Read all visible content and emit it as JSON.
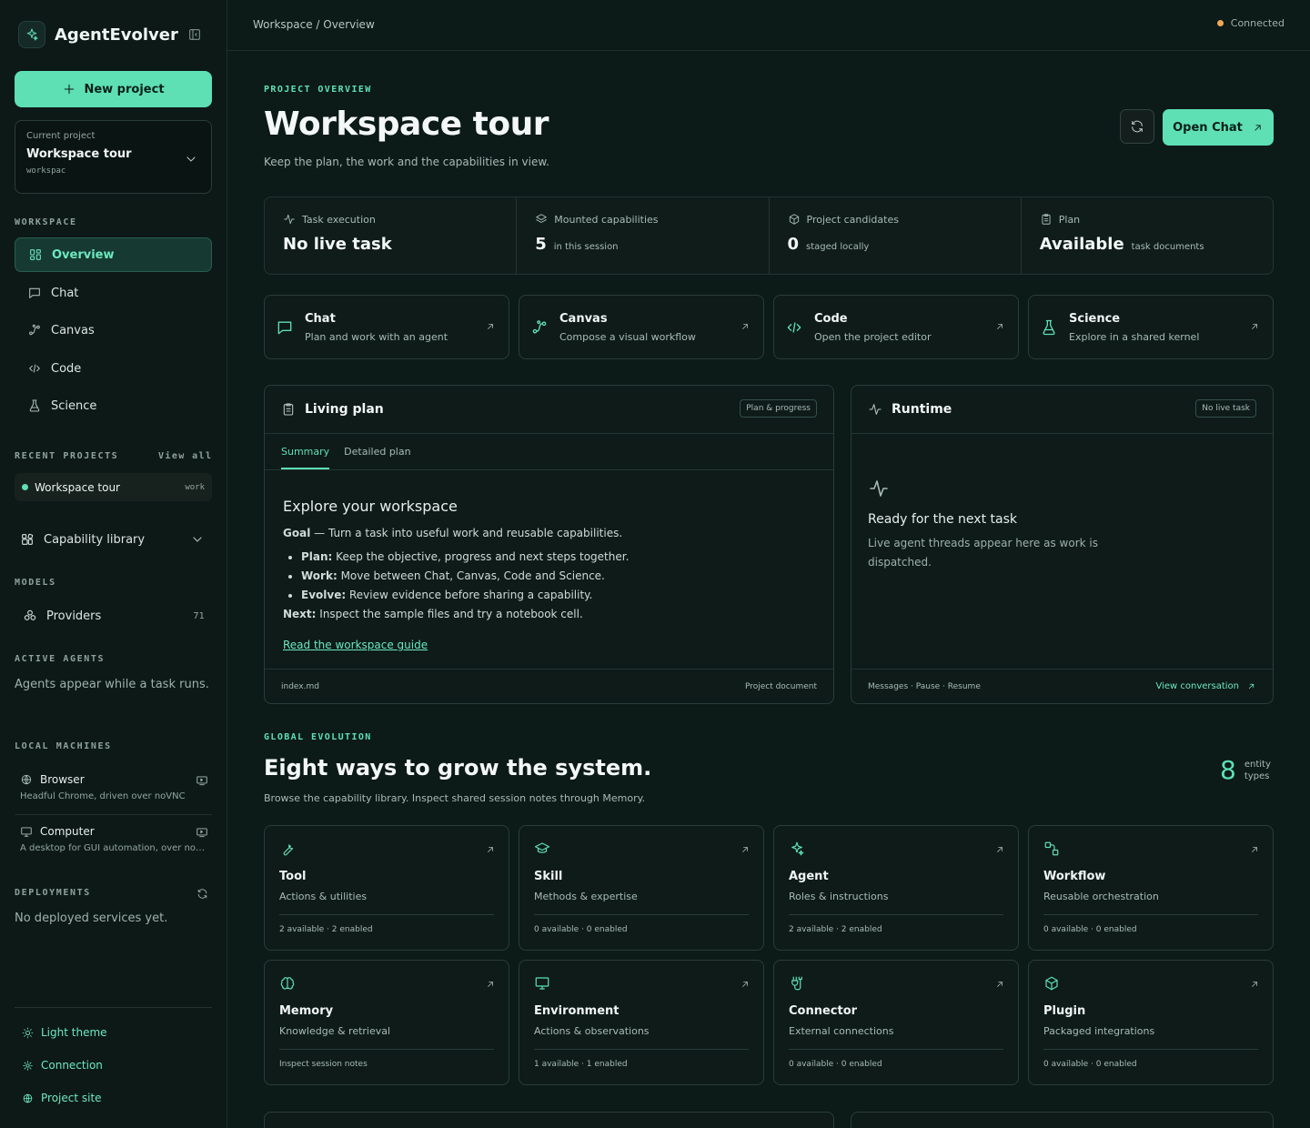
{
  "app": {
    "name": "AgentEvolver"
  },
  "sidebar": {
    "new_project": "New project",
    "project_picker": {
      "caption": "Current project",
      "name": "Workspace tour",
      "slug": "workspac"
    },
    "workspace_label": "WORKSPACE",
    "nav": [
      "Overview",
      "Chat",
      "Canvas",
      "Code",
      "Science"
    ],
    "recent_label": "RECENT PROJECTS",
    "view_all": "View all",
    "recent": {
      "name": "Workspace tour",
      "tag": "work"
    },
    "capability_library": "Capability library",
    "models_label": "MODELS",
    "providers": {
      "label": "Providers",
      "count": "71"
    },
    "active_agents_label": "ACTIVE AGENTS",
    "active_agents_text": "Agents appear while a task runs.",
    "local_machines_label": "LOCAL MACHINES",
    "machines": [
      {
        "name": "Browser",
        "desc": "Headful Chrome, driven over noVNC"
      },
      {
        "name": "Computer",
        "desc": "A desktop for GUI automation, over noVNC"
      }
    ],
    "deployments_label": "DEPLOYMENTS",
    "deployments_text": "No deployed services yet.",
    "footer": [
      "Light theme",
      "Connection",
      "Project site"
    ]
  },
  "topbar": {
    "breadcrumb": "Workspace / Overview",
    "status": "Connected"
  },
  "overview": {
    "eyebrow": "PROJECT OVERVIEW",
    "title": "Workspace tour",
    "subtitle": "Keep the plan, the work and the capabilities in view.",
    "open_chat": "Open Chat",
    "stats": [
      {
        "label": "Task execution",
        "value": "No live task",
        "note": ""
      },
      {
        "label": "Mounted capabilities",
        "value": "5",
        "note": "in this session"
      },
      {
        "label": "Project candidates",
        "value": "0",
        "note": "staged locally"
      },
      {
        "label": "Plan",
        "value": "Available",
        "note": "task documents"
      }
    ],
    "quick": [
      {
        "title": "Chat",
        "sub": "Plan and work with an agent"
      },
      {
        "title": "Canvas",
        "sub": "Compose a visual workflow"
      },
      {
        "title": "Code",
        "sub": "Open the project editor"
      },
      {
        "title": "Science",
        "sub": "Explore in a shared kernel"
      }
    ]
  },
  "plan": {
    "title": "Living plan",
    "badge": "Plan & progress",
    "tabs": [
      "Summary",
      "Detailed plan"
    ],
    "heading": "Explore your workspace",
    "goal_label": "Goal",
    "goal_text": " — Turn a task into useful work and reusable capabilities.",
    "items": [
      {
        "label": "Plan:",
        "text": " Keep the objective, progress and next steps together."
      },
      {
        "label": "Work:",
        "text": " Move between Chat, Canvas, Code and Science."
      },
      {
        "label": "Evolve:",
        "text": " Review evidence before sharing a capability."
      }
    ],
    "next_label": "Next:",
    "next_text": " Inspect the sample files and try a notebook cell.",
    "link": "Read the workspace guide",
    "footer_left": "index.md",
    "footer_right": "Project document"
  },
  "runtime": {
    "title": "Runtime",
    "badge": "No live task",
    "heading": "Ready for the next task",
    "text": "Live agent threads appear here as work is dispatched.",
    "footer_left": "Messages · Pause · Resume",
    "footer_link": "View conversation"
  },
  "evolution": {
    "eyebrow": "GLOBAL EVOLUTION",
    "title": "Eight ways to grow the system.",
    "subtitle": "Browse the capability library. Inspect shared session notes through Memory.",
    "count": "8",
    "count_label_1": "entity",
    "count_label_2": "types",
    "cards": [
      {
        "title": "Tool",
        "sub": "Actions & utilities",
        "foot": "2 available · 2 enabled"
      },
      {
        "title": "Skill",
        "sub": "Methods & expertise",
        "foot": "0 available · 0 enabled"
      },
      {
        "title": "Agent",
        "sub": "Roles & instructions",
        "foot": "2 available · 2 enabled"
      },
      {
        "title": "Workflow",
        "sub": "Reusable orchestration",
        "foot": "0 available · 0 enabled"
      },
      {
        "title": "Memory",
        "sub": "Knowledge & retrieval",
        "foot": "Inspect session notes"
      },
      {
        "title": "Environment",
        "sub": "Actions & observations",
        "foot": "1 available · 1 enabled"
      },
      {
        "title": "Connector",
        "sub": "External connections",
        "foot": "0 available · 0 enabled"
      },
      {
        "title": "Plugin",
        "sub": "Packaged integrations",
        "foot": "0 available · 0 enabled"
      }
    ]
  },
  "colors": {
    "accent": "#5ee0b4",
    "background": "#0c1a18",
    "status_dot": "#f0a856"
  }
}
